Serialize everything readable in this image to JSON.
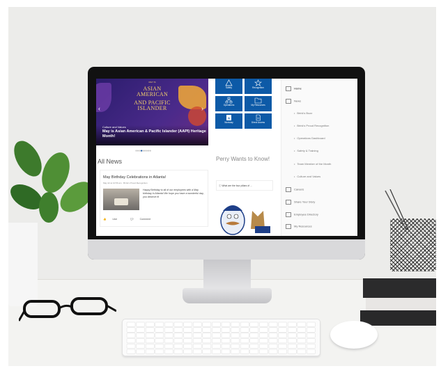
{
  "hero": {
    "small_top": "MAY IS",
    "line1": "ASIAN",
    "line2": "AMERICAN",
    "line3": "AND PACIFIC",
    "line4": "ISLANDER",
    "category": "Culture and Values",
    "title": "May is Asian American & Pacific Islander (AAPI) Heritage Month!"
  },
  "tiles": [
    {
      "label": "Safety",
      "icon": "warning-icon"
    },
    {
      "label": "Recognition",
      "icon": "star-icon"
    },
    {
      "label": "Operations",
      "icon": "org-chart-icon"
    },
    {
      "label": "My Resources",
      "icon": "folder-icon"
    },
    {
      "label": "Workday",
      "icon": "workday-icon"
    },
    {
      "label": "Direct Access",
      "icon": "document-icon"
    }
  ],
  "news": {
    "heading": "All News",
    "card": {
      "title": "May Birthday Celebrations in Atlanta!",
      "meta": "May 22 at 10:56 am · Brink's Proud Recognition",
      "text": "Happy Birthday to all of our employees with a May birthday in Atlanta! We hope you have a wonderful day, you deserve it!",
      "like": "Like",
      "comment": "Comment"
    }
  },
  "perry": {
    "heading": "Perry Wants to Know!",
    "question": "What are the four pillars of ..."
  },
  "nav": {
    "items": [
      {
        "label": "Home",
        "icon": "home-icon"
      },
      {
        "label": "News",
        "icon": "news-icon"
      }
    ],
    "sub_items": [
      "Brink's Buzz",
      "Brink's Proud Recognition",
      "Operations Dashboard",
      "Safety & Training",
      "Team Member of the Month",
      "Culture and Values"
    ],
    "items2": [
      {
        "label": "Careers",
        "icon": "document-icon"
      },
      {
        "label": "Share Your Story",
        "icon": "document-icon"
      },
      {
        "label": "Employee Directory",
        "icon": "people-icon"
      },
      {
        "label": "My Resources",
        "icon": "document-icon"
      }
    ]
  },
  "colors": {
    "tile_blue": "#0d5aa7",
    "hero_purple": "#4a2a8a",
    "gold": "#f6d36b"
  }
}
